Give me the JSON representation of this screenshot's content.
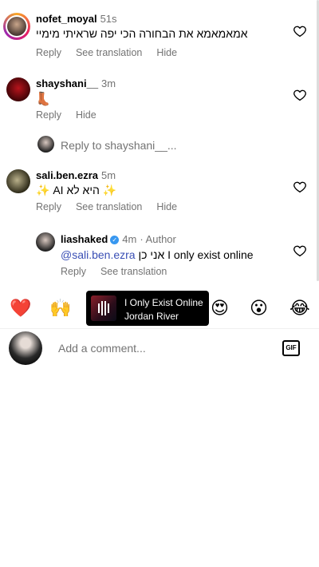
{
  "comments": [
    {
      "username": "nofet_moyal",
      "time": "51s",
      "text": "אמאמאמא את הבחורה הכי יפה שראיתי מימיי",
      "actions": [
        "Reply",
        "See translation",
        "Hide"
      ]
    },
    {
      "username": "shayshani__",
      "time": "3m",
      "text": "👢",
      "actions": [
        "Reply",
        "Hide"
      ],
      "reply_to_label": "Reply to shayshani__..."
    },
    {
      "username": "sali.ben.ezra",
      "time": "5m",
      "text": "✨ היא לא AI ✨",
      "actions": [
        "Reply",
        "See translation",
        "Hide"
      ]
    },
    {
      "username": "liashaked",
      "time": "4m",
      "author_label": "· Author",
      "mention": "@sali.ben.ezra",
      "text": " אני כן I only exist online",
      "actions": [
        "Reply",
        "See translation"
      ]
    }
  ],
  "emoji_bar": [
    "❤️",
    "🙌",
    "😍",
    "😮",
    "😂"
  ],
  "music": {
    "title": "I Only Exist Online",
    "artist": "Jordan River"
  },
  "composer": {
    "placeholder": "Add a comment...",
    "gif_label": "GIF"
  },
  "colors": {
    "mention": "#3a4fb5",
    "secondary_text": "#737373",
    "verified": "#3797f0"
  }
}
